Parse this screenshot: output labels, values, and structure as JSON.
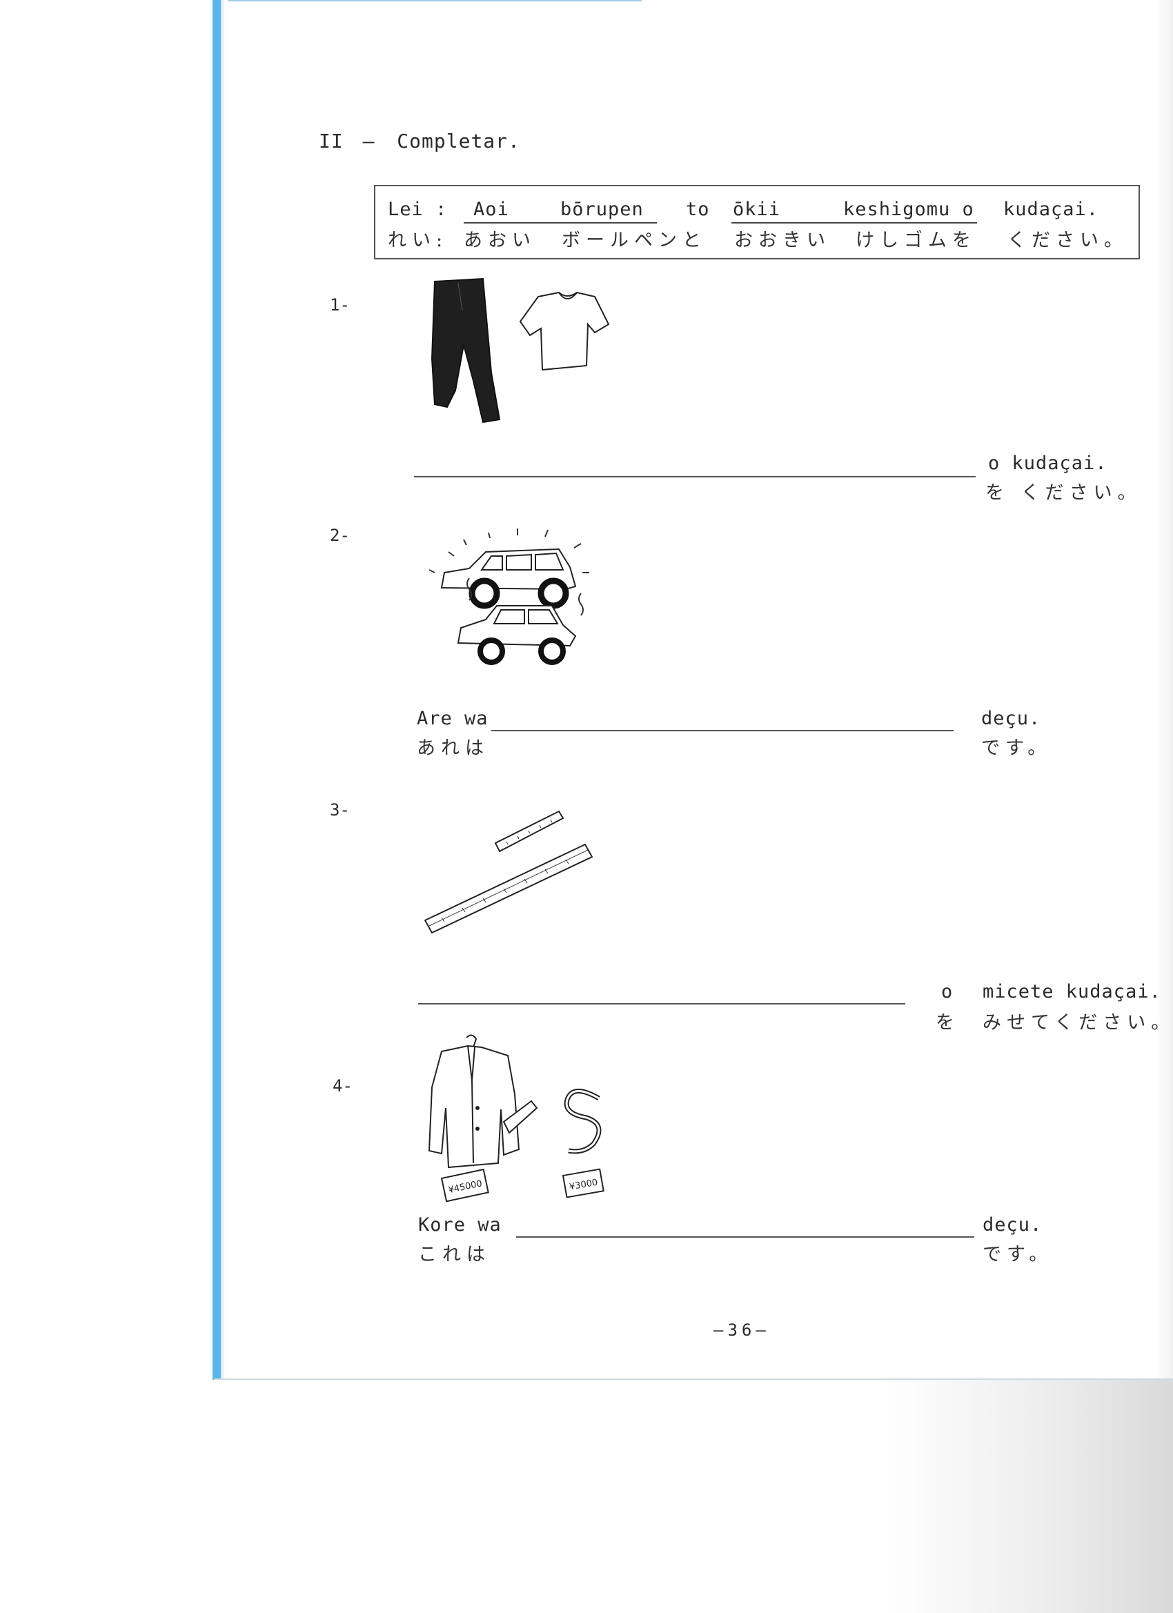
{
  "heading": {
    "roman": "II",
    "dash": "—",
    "text": "Completar."
  },
  "example": {
    "label_romaji": "Lei :",
    "label_kana": "れい:",
    "romaji": [
      "Aoi",
      "bōrupen",
      "to",
      "ōkii",
      "keshigomu o",
      "kudaçai."
    ],
    "kana": [
      "あおい",
      "ボールペンと",
      "おおきい",
      "けしゴムを",
      "ください。"
    ]
  },
  "exercises": [
    {
      "number": "1-",
      "suffix_romaji": "o  kudaçai.",
      "suffix_kana": "を  ください。"
    },
    {
      "number": "2-",
      "prefix_romaji": "Are wa",
      "prefix_kana": "あれは",
      "suffix_romaji": "deçu.",
      "suffix_kana": "です。"
    },
    {
      "number": "3-",
      "suffix_romaji_particle": "o",
      "suffix_kana_particle": "を",
      "suffix_romaji": "micete kudaçai.",
      "suffix_kana": "みせてください。"
    },
    {
      "number": "4-",
      "prefix_romaji": "Kore wa",
      "prefix_kana": "これは",
      "suffix_romaji": "deçu.",
      "suffix_kana": "です。",
      "price_tags": [
        "¥45000",
        "¥3000"
      ]
    }
  ],
  "page_number": "—36—"
}
